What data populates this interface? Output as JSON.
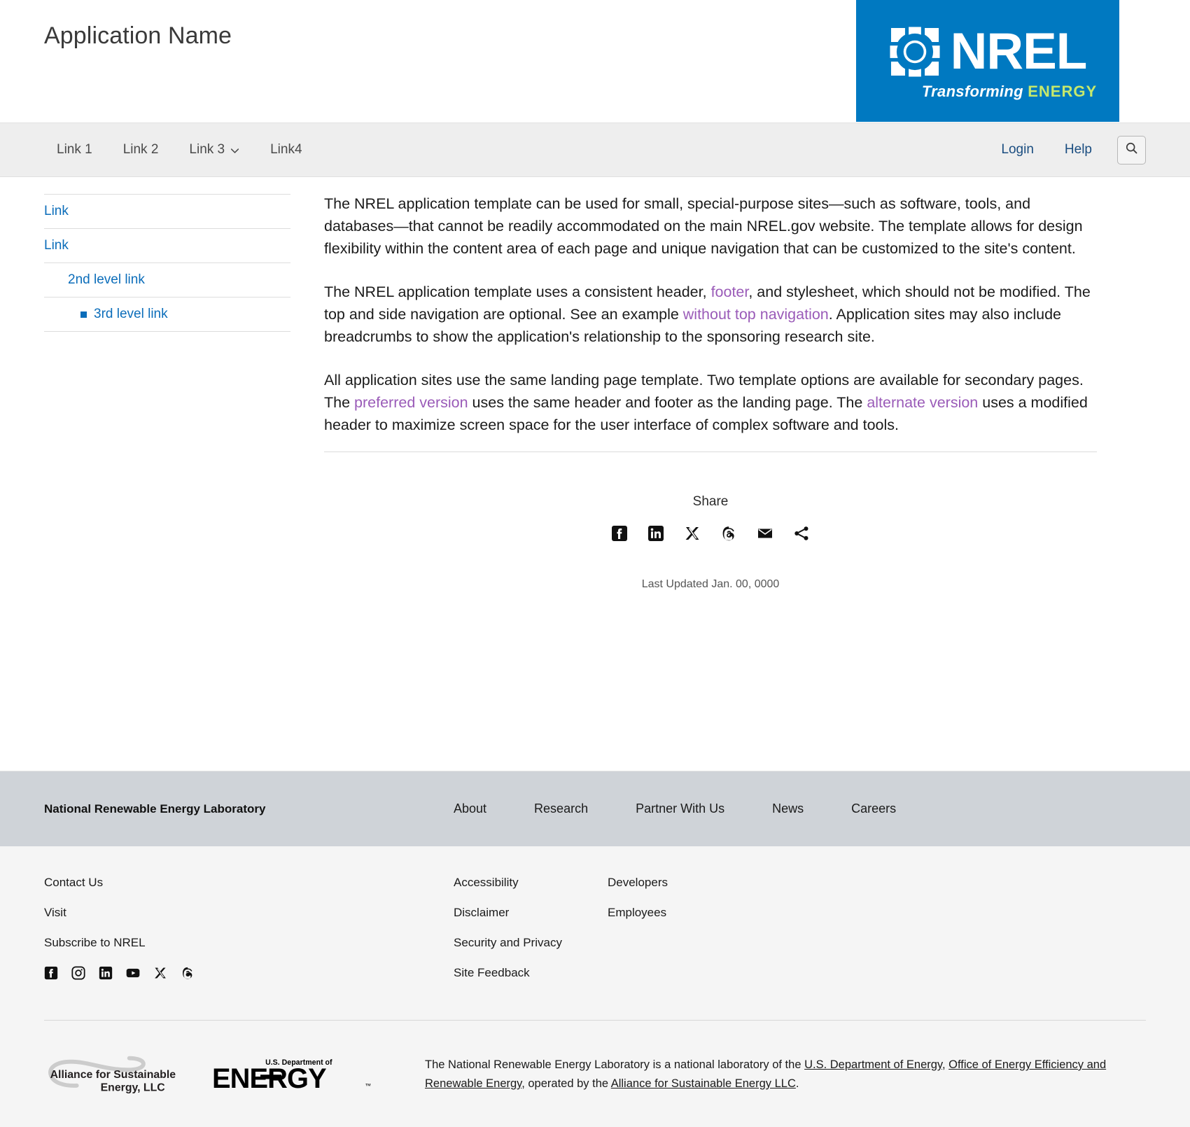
{
  "header": {
    "app_title": "Application Name",
    "logo": {
      "wordmark": "NREL",
      "tagline_1": "Transforming ",
      "tagline_2": "ENERGY",
      "bg_color": "#0079C1",
      "energy_color": "#C5E86C"
    }
  },
  "nav": {
    "links": [
      {
        "label": "Link 1",
        "has_caret": false
      },
      {
        "label": "Link 2",
        "has_caret": false
      },
      {
        "label": "Link 3",
        "has_caret": true
      },
      {
        "label": "Link4",
        "has_caret": false
      }
    ],
    "utility": [
      {
        "label": "Login"
      },
      {
        "label": "Help"
      }
    ],
    "search_icon": "search-icon"
  },
  "sidebar": {
    "items": [
      {
        "label": "Link",
        "level": 1
      },
      {
        "label": "Link",
        "level": 1
      },
      {
        "label": "2nd level link",
        "level": 2
      },
      {
        "label": "3rd level link",
        "level": 3
      }
    ],
    "link_color": "#0B6DBA"
  },
  "main": {
    "paragraphs": {
      "p1": "The NREL application template can be used for small, special-purpose sites—such as software, tools, and databases—that cannot be readily accommodated on the main NREL.gov website. The template allows for design flexibility within the content area of each page and unique navigation that can be customized to the site's content.",
      "p2_a": "The NREL application template uses a consistent header, ",
      "p2_link1": "footer",
      "p2_b": ", and stylesheet, which should not be modified. The top and side navigation are optional. See an example ",
      "p2_link2": "without top navigation",
      "p2_c": ". Application sites may also include breadcrumbs to show the application's relationship to the sponsoring research site.",
      "p3_a": "All application sites use the same landing page template. Two template options are available for secondary pages. The ",
      "p3_link1": "preferred version",
      "p3_b": " uses the same header and footer as the landing page. The ",
      "p3_link2": "alternate version",
      "p3_c": " uses a modified header to maximize screen space for the user interface of complex software and tools."
    },
    "link_color": "#9A5BB8"
  },
  "share": {
    "title": "Share",
    "icons": [
      {
        "name": "facebook-icon"
      },
      {
        "name": "linkedin-icon"
      },
      {
        "name": "x-twitter-icon"
      },
      {
        "name": "threads-icon"
      },
      {
        "name": "email-icon"
      },
      {
        "name": "share-icon"
      }
    ]
  },
  "last_updated": "Last Updated Jan. 00, 0000",
  "footer": {
    "lab_name": "National Renewable Energy Laboratory",
    "band_color": "#CFD3D8",
    "nav_links": [
      {
        "label": "About"
      },
      {
        "label": "Research"
      },
      {
        "label": "Partner With Us"
      },
      {
        "label": "News"
      },
      {
        "label": "Careers"
      }
    ],
    "column_a": [
      {
        "label": "Contact Us"
      },
      {
        "label": "Visit"
      },
      {
        "label": "Subscribe to NREL"
      }
    ],
    "column_b": [
      {
        "label": "Accessibility"
      },
      {
        "label": "Disclaimer"
      },
      {
        "label": "Security and Privacy"
      },
      {
        "label": "Site Feedback"
      }
    ],
    "column_c": [
      {
        "label": "Developers"
      },
      {
        "label": "Employees"
      }
    ],
    "social": [
      {
        "name": "facebook-icon"
      },
      {
        "name": "instagram-icon"
      },
      {
        "name": "linkedin-icon"
      },
      {
        "name": "youtube-icon"
      },
      {
        "name": "x-twitter-icon"
      },
      {
        "name": "threads-icon"
      }
    ],
    "logos": {
      "alliance_line1": "Alliance for Sustainable",
      "alliance_line2": "Energy, LLC",
      "doe_small": "U.S. Department of",
      "doe_word": "ENERGY"
    },
    "legal": {
      "a": "The National Renewable Energy Laboratory is a national laboratory of the ",
      "link1": "U.S. Department of Energy",
      "b": ", ",
      "link2": "Office of Energy Efficiency and Renewable Energy",
      "c": ", operated by the ",
      "link3": "Alliance for Sustainable Energy LLC",
      "d": "."
    }
  }
}
